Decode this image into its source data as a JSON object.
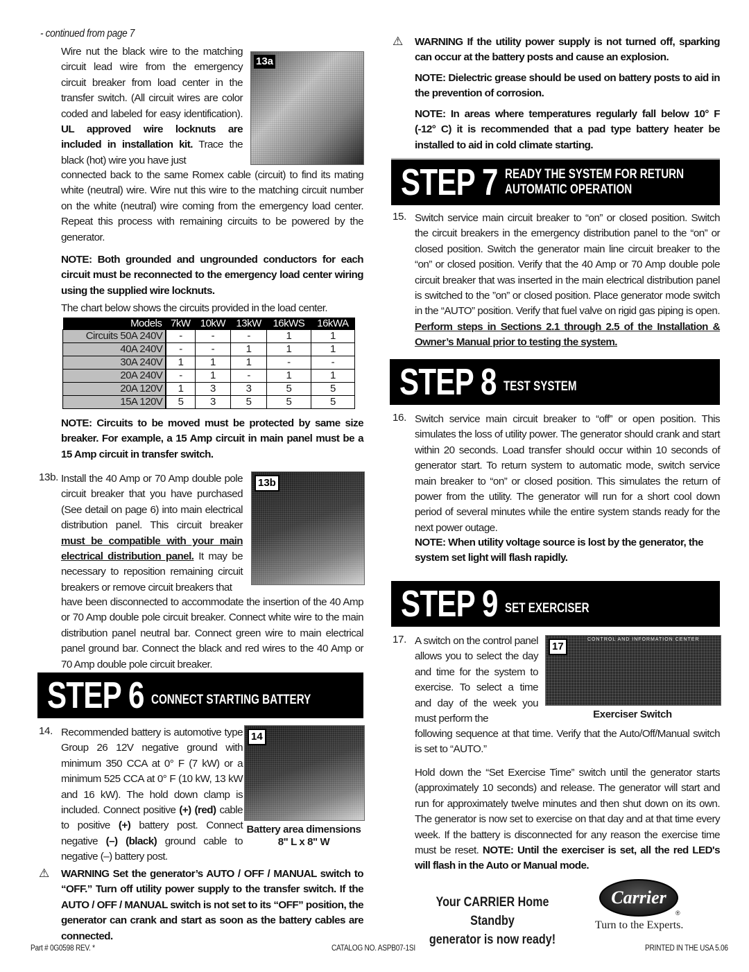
{
  "continued": "- continued from page 7",
  "left": {
    "para13a_intro": "Wire nut the black wire to the matching circuit lead wire from the emergency circuit breaker from load center in the transfer switch. (All circuit wires are color coded and labeled for easy identification). ",
    "para13a_bold": "UL approved wire locknuts are included in installation kit.",
    "para13a_rest": " Trace the black (hot) wire you have just",
    "para13a_cont": "connected back to the same Romex cable (circuit) to find its mating white (neutral) wire. Wire nut this wire to the matching circuit number on the white (neutral) wire coming from the emergency load center. Repeat this process with remaining circuits to be powered by the generator.",
    "photo_13a_label": "13a",
    "note_conductors": "NOTE: Both grounded and ungrounded conductors for each circuit must be reconnected to the emergency load center wiring using the supplied wire locknuts.",
    "chart_intro": "The chart below shows the circuits provided in the load center.",
    "table": {
      "header": [
        "Models",
        "7kW",
        "10kW",
        "13kW",
        "16kWS",
        "16kWA"
      ],
      "rows": [
        {
          "label": "Circuits 50A 240V",
          "values": [
            "-",
            "-",
            "-",
            "1",
            "1"
          ]
        },
        {
          "label": "40A 240V",
          "values": [
            "-",
            "-",
            "1",
            "1",
            "1"
          ]
        },
        {
          "label": "30A 240V",
          "values": [
            "1",
            "1",
            "1",
            "-",
            "-"
          ]
        },
        {
          "label": "20A 240V",
          "values": [
            "-",
            "1",
            "-",
            "1",
            "1"
          ]
        },
        {
          "label": "20A 120V",
          "values": [
            "1",
            "3",
            "3",
            "5",
            "5"
          ]
        },
        {
          "label": "15A 120V",
          "values": [
            "5",
            "3",
            "5",
            "5",
            "5"
          ]
        }
      ]
    },
    "note_circuits": "NOTE: Circuits to be moved must be protected by same size breaker. For example, a 15 Amp circuit in main panel must be a 15 Amp circuit in transfer switch.",
    "step13b_num": "13b.",
    "step13b_intro": "Install the 40 Amp or 70 Amp double pole circuit breaker that you have purchased (See detail on page 6) into main electrical distribution panel. This circuit breaker ",
    "step13b_underline": "must be compatible with your main electrical distribution panel.",
    "step13b_rest": " It may be necessary to reposition remaining circuit breakers or remove circuit breakers that",
    "step13b_cont": "have been disconnected to accommodate the insertion of the 40 Amp or 70 Amp double pole circuit breaker.  Connect white wire to the main distribution panel neutral bar. Connect green wire to main electrical panel ground bar. Connect the black and red wires to the 40 Amp or 70 Amp double pole circuit breaker.",
    "photo_13b_label": "13b",
    "step6": {
      "number": "STEP 6",
      "title": "CONNECT STARTING BATTERY"
    },
    "step14_num": "14.",
    "step14_a": "Recommended battery is automotive type Group 26 12V negative ground with minimum 350 CCA at 0° F (7 kW) or a minimum 525 CCA at 0° F (10 kW, 13 kW and 16 kW). The hold down clamp is included. Connect positive ",
    "step14_pos": "(+) (red)",
    "step14_b": " cable to positive ",
    "step14_pos2": "(+)",
    "step14_c": " battery post. Connect negative ",
    "step14_neg": "(–) (black)",
    "step14_d": " ground cable to negative (–) battery post.",
    "photo_14_label": "14",
    "photo_14_caption": "Battery area dimensions 8\" L x 8\" W",
    "warning_off": "WARNING Set the generator’s AUTO / OFF / MANUAL switch to “OFF.” Turn off utility power supply to the transfer switch. If the  AUTO / OFF / MANUAL switch is not set to its “OFF” position, the generator can crank and start as soon as the battery cables are connected."
  },
  "right": {
    "warning_spark": "WARNING If the utility power supply is not turned off, sparking can occur at the battery posts and cause an explosion.",
    "note_grease": "NOTE: Dielectric grease should be used on battery posts to aid in the prevention of corrosion.",
    "note_cold": "NOTE: In areas where temperatures regularly fall below 10° F (-12° C) it is recommended that a pad type battery heater be installed to aid in cold climate starting.",
    "step7": {
      "number": "STEP 7",
      "title_line1": "READY THE SYSTEM FOR RETURN",
      "title_line2": "AUTOMATIC OPERATION"
    },
    "step15_num": "15.",
    "step15_text": "Switch service main circuit breaker to “on” or closed position. Switch the circuit breakers in the emergency distribution panel to the “on” or closed position.  Switch the generator main line circuit breaker to the “on” or closed position.  Verify that the 40 Amp or 70 Amp double pole circuit breaker that was inserted in the main electrical distribution panel is switched to the ”on” or closed position. Place generator mode switch in the “AUTO” position. Verify that fuel valve on rigid gas piping is open.  ",
    "step15_underline": "Perform steps in Sections 2.1 through 2.5 of the Installation & Owner’s Manual prior to testing the system.",
    "step8": {
      "number": "STEP 8",
      "title": "TEST SYSTEM"
    },
    "step16_num": "16.",
    "step16_text": "Switch service main circuit breaker to “off” or open position. This simulates the loss of utility power. The generator should crank and start within 20 seconds.  Load transfer should occur within 10 seconds of generator start. To return system to automatic mode, switch service main breaker to “on” or closed position. This simulates the return of power from the utility. The generator will run for a short cool down period of several minutes while the entire system stands ready for the next power outage.",
    "step16_note": "NOTE:  When utility voltage source is lost by the generator, the system set light will flash rapidly.",
    "step9": {
      "number": "STEP 9",
      "title": "SET EXERCISER"
    },
    "step17_num": "17.",
    "step17_a": "A switch on the control panel allows you to select the day and time for the system to exercise. To select a time and day of the week you must perform the",
    "step17_b": "following sequence at that time. Verify that the Auto/Off/Manual switch is set to “AUTO.”",
    "photo_17_label": "17",
    "photo_17_panel_title": "CONTROL AND INFORMATION CENTER",
    "photo_17_caption": "Exerciser Switch",
    "hold_text": "Hold down the “Set Exercise Time” switch until the generator starts (approximately 10 seconds) and release. The generator will start and run for approximately twelve minutes and then shut down on its own. The generator is now set to exercise on that day and at that time every week.  If the battery is disconnected for any reason the exercise time must be reset. ",
    "hold_note": "NOTE: Until the exerciser is set, all the red LED's will flash in the Auto or Manual mode.",
    "ready_line1": "Your CARRIER Home Standby",
    "ready_line2": "generator is now ready!",
    "logo_text": "Carrier",
    "logo_reg": "®",
    "tagline": "Turn to the Experts."
  },
  "footer": {
    "part": "Part # 0G0598 REV. *",
    "catalog": "CATALOG NO. ASPB07-1SI",
    "printed": "PRINTED IN THE USA 5.06"
  }
}
